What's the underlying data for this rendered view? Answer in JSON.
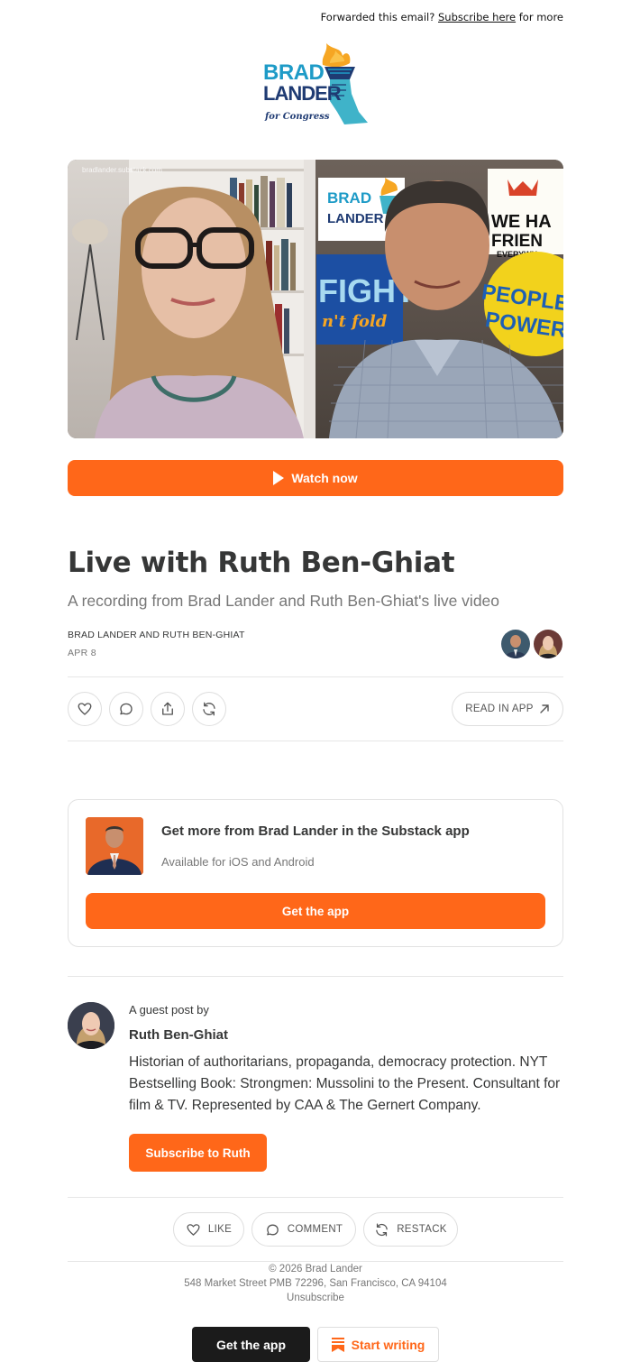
{
  "header": {
    "forward_prefix": "Forwarded this email?",
    "subscribe_link": "Subscribe here",
    "forward_suffix": "for more"
  },
  "logo": {
    "line1": "BRAD",
    "line2": "LANDER",
    "line3": "for Congress",
    "icon": "torch-fist-icon"
  },
  "hero": {
    "watermark": "bradlander.substack.com",
    "poster_brad": "BRAD",
    "poster_lander": "LANDER",
    "poster_fight": "FIGHT",
    "poster_fold": "n't fold",
    "poster_we_have": "WE HA",
    "poster_friends": "FRIEN",
    "poster_everywhere": "EVERYWH",
    "poster_people": "PEOPLE",
    "poster_power": "POWER"
  },
  "watch_button": {
    "label": "Watch now",
    "icon": "play-icon"
  },
  "post": {
    "title": "Live with Ruth Ben-Ghiat",
    "subtitle": "A recording from Brad Lander and Ruth Ben-Ghiat's live video",
    "authors": "BRAD LANDER AND RUTH BEN-GHIAT",
    "date": "APR 8"
  },
  "actions": {
    "like_icon": "heart-icon",
    "comment_icon": "comment-icon",
    "share_icon": "share-icon",
    "restack_icon": "restack-icon",
    "read_in_app": "READ IN APP"
  },
  "app_promo": {
    "title": "Get more from Brad Lander in the Substack app",
    "subtitle": "Available for iOS and Android",
    "button": "Get the app"
  },
  "guest": {
    "label": "A guest post by",
    "name": "Ruth Ben-Ghiat",
    "bio": "Historian of authoritarians, propaganda, democracy protection. NYT Bestselling Book: Strongmen: Mussolini to the Present. Consultant for film & TV. Represented by CAA & The Gernert Company.",
    "subscribe_button": "Subscribe to Ruth"
  },
  "bottom_actions": {
    "like": "LIKE",
    "comment": "COMMENT",
    "restack": "RESTACK"
  },
  "footer": {
    "copyright": "© 2026 Brad Lander",
    "address": "548 Market Street PMB 72296, San Francisco, CA 94104",
    "unsubscribe": "Unsubscribe",
    "get_app": "Get the app",
    "start_writing": "Start writing"
  },
  "colors": {
    "accent": "#FF6719",
    "text": "#363737",
    "muted": "#777777",
    "logo_blue": "#1E9BC7",
    "logo_navy": "#1F3B73",
    "logo_orange": "#F6A623"
  }
}
